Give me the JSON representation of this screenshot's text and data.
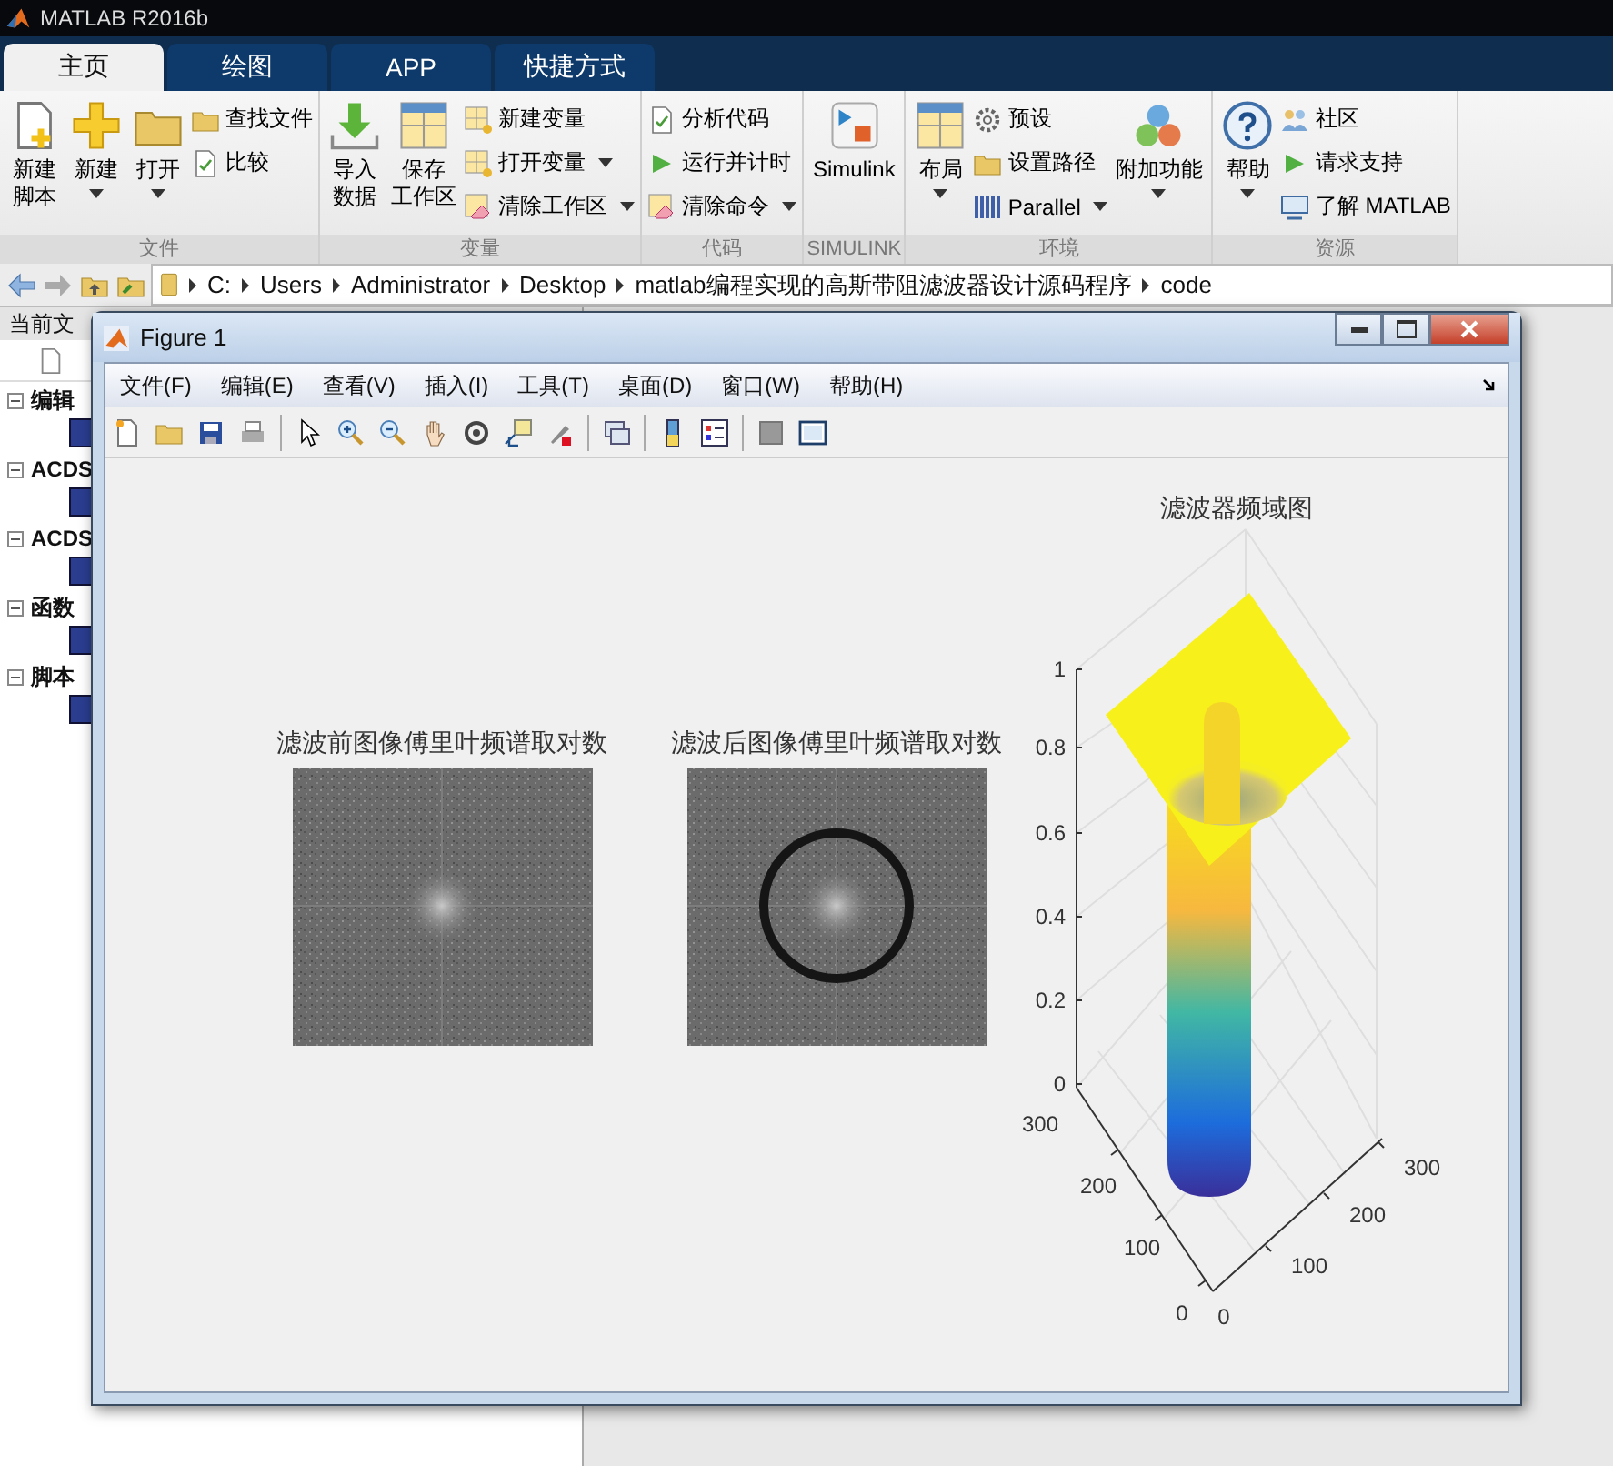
{
  "app_title": "MATLAB R2016b",
  "tabs": [
    {
      "label": "主页",
      "selected": true
    },
    {
      "label": "绘图",
      "selected": false
    },
    {
      "label": "APP",
      "selected": false
    },
    {
      "label": "快捷方式",
      "selected": false
    }
  ],
  "ribbon": {
    "groups": [
      {
        "label": "文件",
        "blocks": [
          {
            "kind": "large",
            "lines": [
              "新建",
              "脚本"
            ],
            "dropdown": false
          },
          {
            "kind": "large",
            "lines": [
              "新建"
            ],
            "dropdown": true
          },
          {
            "kind": "large",
            "lines": [
              "打开"
            ],
            "dropdown": true
          },
          {
            "kind": "stack",
            "items": [
              {
                "label": "查找文件",
                "dropdown": false
              },
              {
                "label": "比较",
                "dropdown": false
              }
            ]
          }
        ]
      },
      {
        "label": "变量",
        "blocks": [
          {
            "kind": "large",
            "lines": [
              "导入",
              "数据"
            ],
            "dropdown": false
          },
          {
            "kind": "large",
            "lines": [
              "保存",
              "工作区"
            ],
            "dropdown": false
          },
          {
            "kind": "stack",
            "items": [
              {
                "label": "新建变量",
                "dropdown": false
              },
              {
                "label": "打开变量",
                "dropdown": true
              },
              {
                "label": "清除工作区",
                "dropdown": true
              }
            ]
          }
        ]
      },
      {
        "label": "代码",
        "blocks": [
          {
            "kind": "stack",
            "items": [
              {
                "label": "分析代码",
                "dropdown": false
              },
              {
                "label": "运行并计时",
                "dropdown": false
              },
              {
                "label": "清除命令",
                "dropdown": true
              }
            ]
          }
        ]
      },
      {
        "label": "SIMULINK",
        "blocks": [
          {
            "kind": "large",
            "lines": [
              "Simulink"
            ],
            "dropdown": false
          }
        ]
      },
      {
        "label": "环境",
        "blocks": [
          {
            "kind": "large",
            "lines": [
              "布局"
            ],
            "dropdown": true
          },
          {
            "kind": "stack",
            "items": [
              {
                "label": "预设",
                "dropdown": false
              },
              {
                "label": "设置路径",
                "dropdown": false
              },
              {
                "label": "Parallel",
                "dropdown": true
              }
            ]
          },
          {
            "kind": "large",
            "lines": [
              "附加功能"
            ],
            "dropdown": true
          }
        ]
      },
      {
        "label": "资源",
        "blocks": [
          {
            "kind": "large",
            "lines": [
              "帮助"
            ],
            "dropdown": true
          },
          {
            "kind": "stack",
            "items": [
              {
                "label": "社区",
                "dropdown": false
              },
              {
                "label": "请求支持",
                "dropdown": false
              },
              {
                "label": "了解 MATLAB",
                "dropdown": false
              }
            ]
          }
        ]
      }
    ]
  },
  "address_bar": {
    "segments": [
      "C:",
      "Users",
      "Administrator",
      "Desktop",
      "matlab编程实现的高斯带阻滤波器设计源码程序",
      "code"
    ]
  },
  "file_panel": {
    "header": "当前文",
    "sections": [
      {
        "label": "编辑",
        "expanded": true
      },
      {
        "label": "ACDS",
        "expanded": true
      },
      {
        "label": "ACDS",
        "expanded": true
      },
      {
        "label": "函数",
        "expanded": true
      },
      {
        "label": "脚本",
        "expanded": true
      }
    ]
  },
  "figure": {
    "title": "Figure 1",
    "menu": [
      "文件(F)",
      "编辑(E)",
      "查看(V)",
      "插入(I)",
      "工具(T)",
      "桌面(D)",
      "窗口(W)",
      "帮助(H)"
    ],
    "images": [
      {
        "title": "滤波前图像傅里叶频谱取对数",
        "kind": "spectrum"
      },
      {
        "title": "滤波后图像傅里叶频谱取对数",
        "kind": "ring-spectrum"
      }
    ],
    "surface_plot": {
      "title": "滤波器频域图",
      "z_ticks": [
        "1",
        "0.8",
        "0.6",
        "0.4",
        "0.2",
        "0"
      ],
      "y_ticks": [
        "300",
        "200",
        "100",
        "0"
      ],
      "x_ticks": [
        "300",
        "200",
        "100",
        "0"
      ]
    }
  }
}
